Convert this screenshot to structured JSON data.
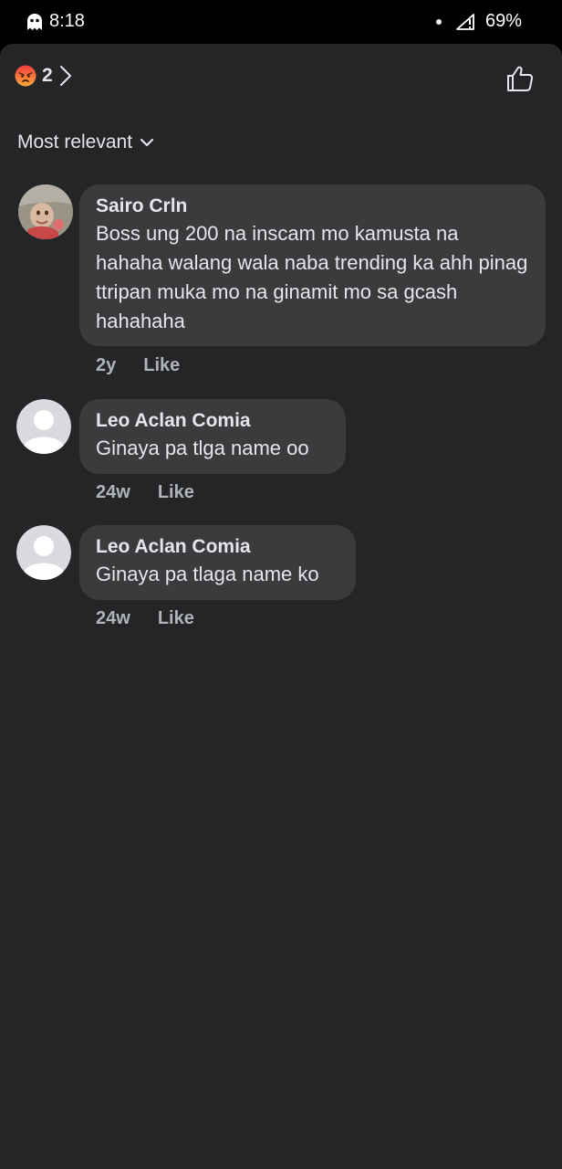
{
  "status_bar": {
    "time": "8:18",
    "battery": "69%",
    "icons": [
      "ghost-icon",
      "dot-icon",
      "signal-off-icon"
    ]
  },
  "header": {
    "reaction_icon": "angry-emoji-icon",
    "reaction_count": "2",
    "like_icon": "thumbs-up-icon"
  },
  "sort": {
    "label": "Most relevant",
    "icon": "chevron-down-icon"
  },
  "comments": [
    {
      "author": "Sairo Crln",
      "text": "Boss ung 200 na inscam mo kamusta na hahaha walang wala naba trending ka ahh pinag ttripan muka mo na ginamit mo sa gcash hahahaha",
      "time": "2y",
      "like_label": "Like",
      "avatar": "photo"
    },
    {
      "author": "Leo Aclan Comia",
      "text": "Ginaya pa tlga name oo",
      "time": "24w",
      "like_label": "Like",
      "avatar": "default"
    },
    {
      "author": "Leo Aclan Comia",
      "text": "Ginaya pa tlaga name ko",
      "time": "24w",
      "like_label": "Like",
      "avatar": "default"
    }
  ],
  "colors": {
    "background": "#242526",
    "bubble": "#3a3b3c",
    "text_primary": "#e4e6eb",
    "text_secondary": "#b0b3b8",
    "reaction_angry": "#e9710f"
  }
}
